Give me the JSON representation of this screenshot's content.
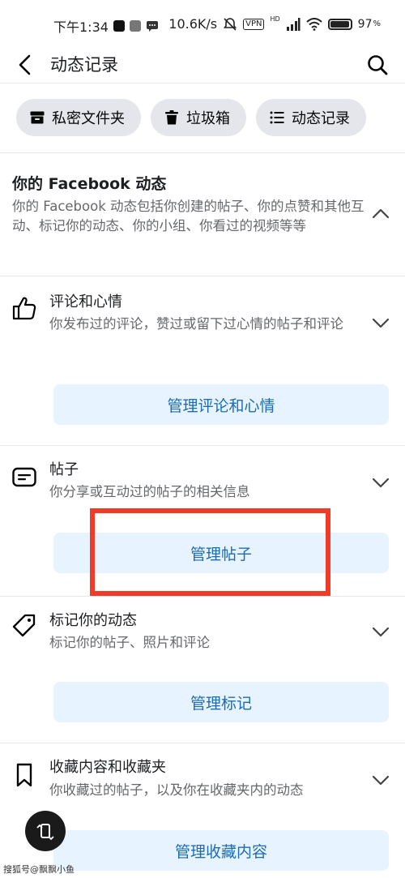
{
  "status_bar": {
    "time": "下午1:34",
    "speed": "10.6K/s",
    "vpn": "VPN",
    "hd": "HD",
    "battery": "97",
    "battery_level": 0.97
  },
  "app_bar": {
    "title": "动态记录"
  },
  "chips": [
    {
      "label": "私密文件夹",
      "icon": "archive-box-icon"
    },
    {
      "label": "垃圾箱",
      "icon": "trash-icon"
    },
    {
      "label": "动态记录",
      "icon": "list-icon"
    }
  ],
  "section": {
    "title": "你的 Facebook 动态",
    "description": "你的 Facebook 动态包括你创建的帖子、你的点赞和其他互动、标记你的动态、你的小组、你看过的视频等等"
  },
  "items": [
    {
      "title": "评论和心情",
      "description": "你发布过的评论，赞过或留下过心情的帖子和评论",
      "button": "管理评论和心情",
      "icon": "thumbs-up-icon"
    },
    {
      "title": "帖子",
      "description": "你分享或互动过的帖子的相关信息",
      "button": "管理帖子",
      "icon": "post-icon"
    },
    {
      "title": "标记你的动态",
      "description": "标记你的帖子、照片和评论",
      "button": "管理标记",
      "icon": "tag-icon"
    },
    {
      "title": "收藏内容和收藏夹",
      "description": "你收藏过的帖子，以及你在收藏夹内的动态",
      "button": "管理收藏内容",
      "icon": "bookmark-icon"
    }
  ],
  "watermark": "搜狐号@飘飘小鱼",
  "colors": {
    "accent_text": "#1b6cb4",
    "button_bg": "#e7f3ff",
    "highlight": "#ef3b27",
    "chip_bg": "#e4e6eb"
  }
}
